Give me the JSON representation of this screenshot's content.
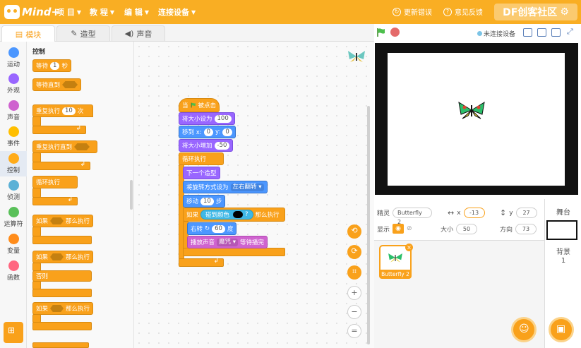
{
  "app": {
    "logo_text": "Mind+"
  },
  "menu": [
    {
      "label": "项 目",
      "caret": "▼"
    },
    {
      "label": "教 程",
      "caret": "▼"
    },
    {
      "label": "编 辑",
      "caret": "▼"
    },
    {
      "label": "连接设备",
      "caret": "▼"
    }
  ],
  "topright": {
    "update_error": "更新错误",
    "feedback": "意见反馈",
    "df_badge": "DF创客社区"
  },
  "tabs": [
    {
      "label": "模块"
    },
    {
      "label": "造型"
    },
    {
      "label": "声音"
    }
  ],
  "stagebar": {
    "connection": "未连接设备"
  },
  "categories": [
    {
      "label": "运动",
      "color": "#4c97ff"
    },
    {
      "label": "外观",
      "color": "#9966ff"
    },
    {
      "label": "声音",
      "color": "#cf63cf"
    },
    {
      "label": "事件",
      "color": "#ffbf00"
    },
    {
      "label": "控制",
      "color": "#ffab19"
    },
    {
      "label": "侦测",
      "color": "#5cb1d6"
    },
    {
      "label": "运算符",
      "color": "#59c059"
    },
    {
      "label": "变量",
      "color": "#ff8c1a"
    },
    {
      "label": "函数",
      "color": "#ff6680"
    }
  ],
  "palette": {
    "title": "控制",
    "wait": "等待",
    "wait_val": "1",
    "wait_unit": "秒",
    "wait_until": "等待直到",
    "repeat": "重复执行",
    "repeat_val": "10",
    "repeat_unit": "次",
    "repeat_until": "重复执行直到",
    "forever": "循环执行",
    "if1": "如果",
    "then1": "那么执行",
    "if2": "如果",
    "then2": "那么执行",
    "else": "否则",
    "if3": "如果",
    "then3": "那么执行"
  },
  "script": {
    "hat_when": "当",
    "hat_clicked": "被点击",
    "set_size": "将大小设为",
    "set_size_val": "100",
    "goto": "移到 x:",
    "goto_x": "0",
    "goto_y_label": "y:",
    "goto_y": "0",
    "change_size": "将大小增加",
    "change_size_val": "-50",
    "forever": "循环执行",
    "next_costume": "下一个造型",
    "rotation": "将旋转方式设为",
    "rotation_val": "左右翻转",
    "move": "移动",
    "move_val": "10",
    "move_unit": "步",
    "if": "如果",
    "touch_color": "碰到颜色",
    "q": "?",
    "then": "那么执行",
    "turn": "右转",
    "turn_val": "60",
    "turn_unit": "度",
    "play": "播放声音",
    "sound_name": "魔咒",
    "play_until": "等待播完"
  },
  "sprite": {
    "label_name": "精灵",
    "name": "Butterfly 2",
    "label_x": "x",
    "x": "-13",
    "label_y": "y",
    "y": "27",
    "label_show": "显示",
    "label_size": "大小",
    "size": "50",
    "label_dir": "方向",
    "dir": "73",
    "card_name": "Butterfly 2"
  },
  "stage_panel": {
    "title": "舞台",
    "backdrop_label": "背景",
    "backdrop_count": "1"
  },
  "zoom": {
    "in": "+",
    "out": "−",
    "reset": "="
  }
}
